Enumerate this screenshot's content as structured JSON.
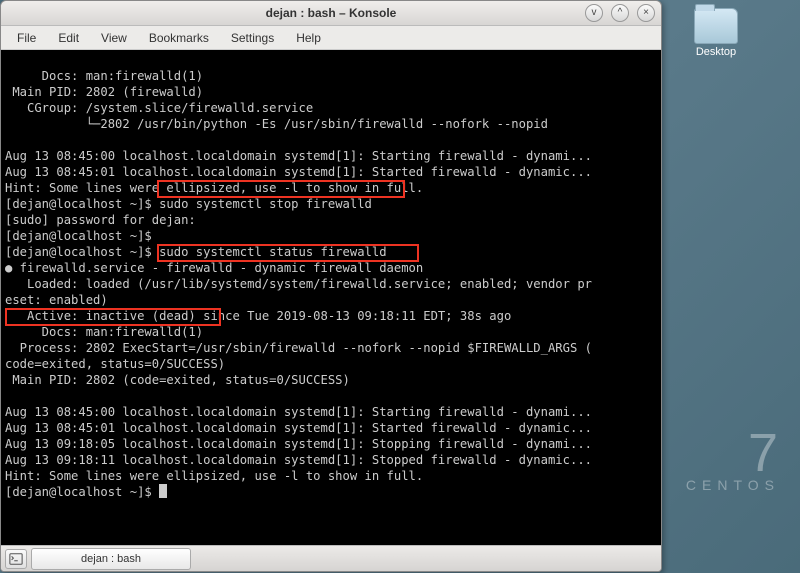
{
  "desktop": {
    "folder_label": "Desktop"
  },
  "centos": {
    "version": "7",
    "name": "CENTOS"
  },
  "window": {
    "title": "dejan : bash – Konsole",
    "btn_min": "v",
    "btn_max": "^",
    "btn_close": "×"
  },
  "menu": {
    "file": "File",
    "edit": "Edit",
    "view": "View",
    "bookmarks": "Bookmarks",
    "settings": "Settings",
    "help": "Help"
  },
  "tabbar": {
    "tab_label": "dejan : bash"
  },
  "term": {
    "l01": "     Docs: man:firewalld(1)",
    "l02": " Main PID: 2802 (firewalld)",
    "l03": "   CGroup: /system.slice/firewalld.service",
    "l04": "           └─2802 /usr/bin/python -Es /usr/sbin/firewalld --nofork --nopid",
    "l05": "",
    "l06": "Aug 13 08:45:00 localhost.localdomain systemd[1]: Starting firewalld - dynami...",
    "l07": "Aug 13 08:45:01 localhost.localdomain systemd[1]: Started firewalld - dynamic...",
    "l08": "Hint: Some lines were ellipsized, use -l to show in full.",
    "p1_prompt": "[dejan@localhost ~]$ ",
    "p1_cmd": "sudo systemctl stop firewalld",
    "l10": "[sudo] password for dejan:",
    "p2_prompt": "[dejan@localhost ~]$ ",
    "p3_prompt": "[dejan@localhost ~]$ ",
    "p3_cmd": "sudo systemctl status firewalld",
    "l13a": "● firewalld.service - firewalld - dynamic firewall daemon",
    "l14": "   Loaded: loaded (/usr/lib/systemd/system/firewalld.service; enabled; vendor pr",
    "l15": "eset: enabled)",
    "l16a": "   Active: inactive (dead)",
    "l16b": " since Tue 2019-08-13 09:18:11 EDT; 38s ago",
    "l17": "     Docs: man:firewalld(1)",
    "l18": "  Process: 2802 ExecStart=/usr/sbin/firewalld --nofork --nopid $FIREWALLD_ARGS (",
    "l19": "code=exited, status=0/SUCCESS)",
    "l20": " Main PID: 2802 (code=exited, status=0/SUCCESS)",
    "l21": "",
    "l22": "Aug 13 08:45:00 localhost.localdomain systemd[1]: Starting firewalld - dynami...",
    "l23": "Aug 13 08:45:01 localhost.localdomain systemd[1]: Started firewalld - dynamic...",
    "l24": "Aug 13 09:18:05 localhost.localdomain systemd[1]: Stopping firewalld - dynami...",
    "l25": "Aug 13 09:18:11 localhost.localdomain systemd[1]: Stopped firewalld - dynamic...",
    "l26": "Hint: Some lines were ellipsized, use -l to show in full.",
    "p4_prompt": "[dejan@localhost ~]$ "
  }
}
